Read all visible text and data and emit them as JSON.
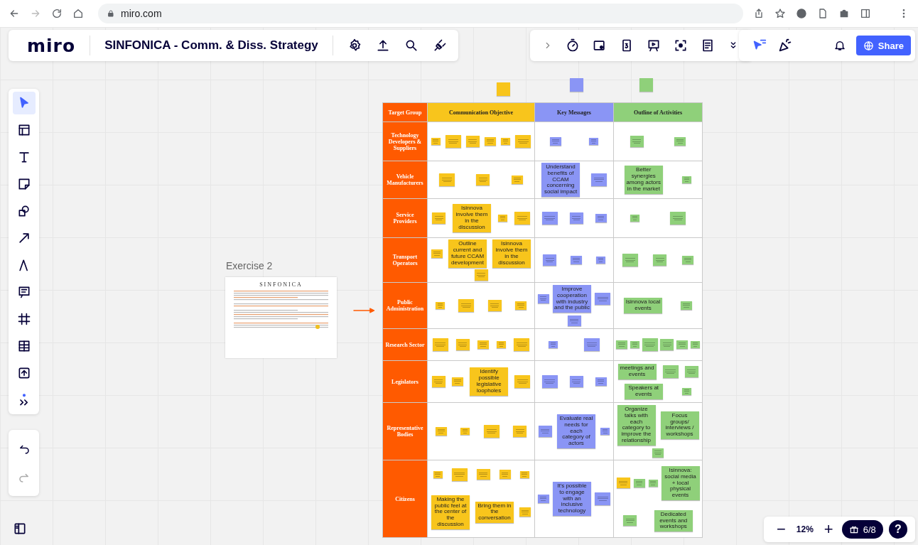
{
  "browser": {
    "address": "miro.com"
  },
  "board_header": {
    "logo": "miro",
    "title": "SINFONICA - Comm. & Diss. Strategy"
  },
  "share_button": "Share",
  "tools": [
    {
      "kind": "select",
      "selected": true
    },
    {
      "kind": "templates",
      "selected": false
    },
    {
      "kind": "text",
      "selected": false
    },
    {
      "kind": "sticky",
      "selected": false
    },
    {
      "kind": "shapes",
      "selected": false
    },
    {
      "kind": "line",
      "selected": false
    },
    {
      "kind": "pen",
      "selected": false
    },
    {
      "kind": "comment",
      "selected": false
    },
    {
      "kind": "frame",
      "selected": false
    },
    {
      "kind": "table",
      "selected": false
    },
    {
      "kind": "upload",
      "selected": false
    },
    {
      "kind": "more",
      "selected": false
    }
  ],
  "frame_title": "Exercise 2",
  "document": {
    "logo": "SINFONICA"
  },
  "table": {
    "columns": [
      {
        "label": "Target Group",
        "color": "#ff5a00"
      },
      {
        "label": "Communication Objective",
        "color": "#f8c51c"
      },
      {
        "label": "Key Messages",
        "color": "#8a95f5"
      },
      {
        "label": "Outline of Activities",
        "color": "#8fd07a"
      }
    ],
    "rows": [
      {
        "target_group": "Technology Developers & Suppliers",
        "communication_objective": [
          {
            "kind": "blank"
          },
          {
            "kind": "blank"
          },
          {
            "kind": "blank"
          },
          {
            "kind": "blank"
          },
          {
            "kind": "blank"
          },
          {
            "kind": "blank"
          }
        ],
        "key_messages": [
          {
            "kind": "blank"
          },
          {
            "kind": "blank"
          }
        ],
        "outline_of_activities": [
          {
            "kind": "blank"
          },
          {
            "kind": "blank"
          }
        ]
      },
      {
        "target_group": "Vehicle Manufacturers",
        "communication_objective": [
          {
            "kind": "blank"
          },
          {
            "kind": "blank"
          },
          {
            "kind": "blank"
          }
        ],
        "key_messages": [
          {
            "kind": "text",
            "text": "Understand benefits of CCAM concerning social impact"
          },
          {
            "kind": "blank"
          }
        ],
        "outline_of_activities": [
          {
            "kind": "text",
            "text": "Better synergies among actors in the market"
          },
          {
            "kind": "blank"
          }
        ]
      },
      {
        "target_group": "Service Providers",
        "communication_objective": [
          {
            "kind": "blank"
          },
          {
            "kind": "text",
            "text": "Isinnova involve them in the discussion"
          },
          {
            "kind": "blank"
          },
          {
            "kind": "blank"
          }
        ],
        "key_messages": [
          {
            "kind": "blank"
          },
          {
            "kind": "blank"
          },
          {
            "kind": "blank"
          }
        ],
        "outline_of_activities": [
          {
            "kind": "blank"
          },
          {
            "kind": "blank"
          }
        ]
      },
      {
        "target_group": "Transport Operators",
        "communication_objective": [
          {
            "kind": "blank"
          },
          {
            "kind": "text",
            "text": "Outline current and future CCAM development"
          },
          {
            "kind": "text",
            "text": "Isinnova involve them in the discussion"
          },
          {
            "kind": "blank"
          }
        ],
        "key_messages": [
          {
            "kind": "blank"
          },
          {
            "kind": "blank"
          },
          {
            "kind": "blank"
          }
        ],
        "outline_of_activities": [
          {
            "kind": "blank"
          },
          {
            "kind": "blank"
          },
          {
            "kind": "blank"
          }
        ]
      },
      {
        "target_group": "Public Administration",
        "communication_objective": [
          {
            "kind": "blank"
          },
          {
            "kind": "blank"
          },
          {
            "kind": "blank"
          },
          {
            "kind": "blank"
          }
        ],
        "key_messages": [
          {
            "kind": "blank"
          },
          {
            "kind": "text",
            "text": "Improve cooperation with industry and the public"
          },
          {
            "kind": "blank"
          },
          {
            "kind": "blank"
          }
        ],
        "outline_of_activities": [
          {
            "kind": "text",
            "text": "Isinnova local events"
          },
          {
            "kind": "blank"
          }
        ]
      },
      {
        "target_group": "Research Sector",
        "communication_objective": [
          {
            "kind": "blank"
          },
          {
            "kind": "blank"
          },
          {
            "kind": "blank"
          },
          {
            "kind": "blank"
          },
          {
            "kind": "blank"
          }
        ],
        "key_messages": [
          {
            "kind": "blank"
          },
          {
            "kind": "blank"
          }
        ],
        "outline_of_activities": [
          {
            "kind": "blank"
          },
          {
            "kind": "blank"
          },
          {
            "kind": "blank"
          },
          {
            "kind": "blank"
          },
          {
            "kind": "blank"
          },
          {
            "kind": "blank"
          }
        ]
      },
      {
        "target_group": "Legislators",
        "communication_objective": [
          {
            "kind": "blank"
          },
          {
            "kind": "blank"
          },
          {
            "kind": "text",
            "text": "Identify possible legislative loopholes"
          },
          {
            "kind": "blank"
          }
        ],
        "key_messages": [
          {
            "kind": "blank"
          },
          {
            "kind": "blank"
          },
          {
            "kind": "blank"
          }
        ],
        "outline_of_activities": [
          {
            "kind": "text",
            "text": "meetings and events"
          },
          {
            "kind": "blank"
          },
          {
            "kind": "blank"
          },
          {
            "kind": "text",
            "text": "Speakers at events"
          },
          {
            "kind": "blank"
          }
        ]
      },
      {
        "target_group": "Representative Bodies",
        "communication_objective": [
          {
            "kind": "blank"
          },
          {
            "kind": "blank"
          },
          {
            "kind": "blank"
          },
          {
            "kind": "blank"
          }
        ],
        "key_messages": [
          {
            "kind": "blank"
          },
          {
            "kind": "text",
            "text": "Evaluate real needs for each category of actors"
          },
          {
            "kind": "blank"
          }
        ],
        "outline_of_activities": [
          {
            "kind": "text",
            "text": "Organize talks with each category to improve the relationship"
          },
          {
            "kind": "text",
            "text": "Focus groups/ interviews / workshops"
          },
          {
            "kind": "blank"
          }
        ]
      },
      {
        "target_group": "Citizens",
        "communication_objective": [
          {
            "kind": "blank"
          },
          {
            "kind": "blank"
          },
          {
            "kind": "blank"
          },
          {
            "kind": "blank"
          },
          {
            "kind": "blank"
          },
          {
            "kind": "text",
            "text": "Making the public feel at the center of the discussion"
          },
          {
            "kind": "text",
            "text": "Bring them in the conversation"
          },
          {
            "kind": "blank"
          }
        ],
        "key_messages": [
          {
            "kind": "blank"
          },
          {
            "kind": "text",
            "text": "It's possible to engage with an inclusive technology"
          },
          {
            "kind": "blank"
          }
        ],
        "outline_of_activities": [
          {
            "kind": "blank",
            "color": "#f8c51c"
          },
          {
            "kind": "blank"
          },
          {
            "kind": "blank"
          },
          {
            "kind": "text",
            "text": "Isinnova: social media + local physical events"
          },
          {
            "kind": "blank"
          },
          {
            "kind": "text",
            "text": "Dedicated events and workshops"
          }
        ]
      }
    ]
  },
  "floating_notes": [
    {
      "color": "#f8c51c"
    },
    {
      "color": "#8a95f5"
    },
    {
      "color": "#8fd07a"
    }
  ],
  "zoom": {
    "minus": "−",
    "value": "12%",
    "plus": "+"
  },
  "progress_badge": "6/8",
  "help": "?"
}
